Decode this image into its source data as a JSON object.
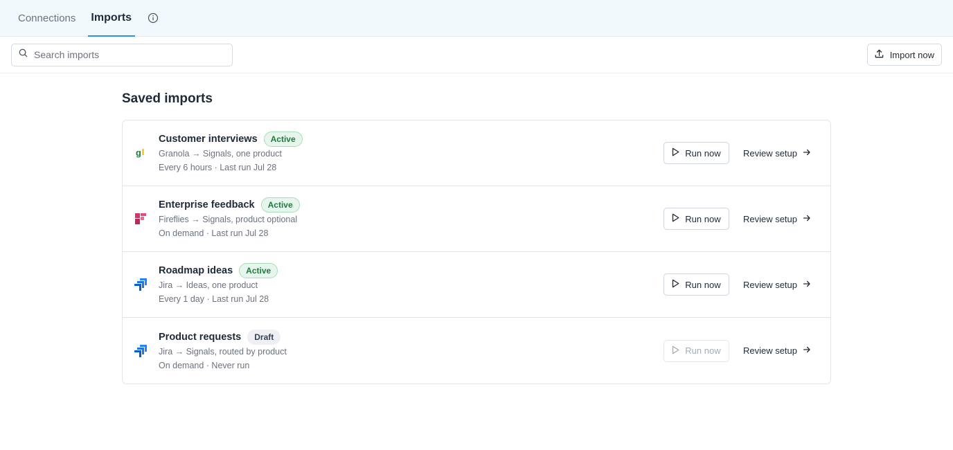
{
  "tabs": [
    {
      "label": "Connections",
      "active": false
    },
    {
      "label": "Imports",
      "active": true
    }
  ],
  "search": {
    "placeholder": "Search imports",
    "value": ""
  },
  "toolbar": {
    "import_label": "Import now"
  },
  "section": {
    "title": "Saved imports"
  },
  "imports": [
    {
      "title": "Customer interviews",
      "status": "Active",
      "source_line": "Granola → Signals, one product",
      "schedule_line": "Every 6 hours · Last run Jul 28",
      "icon": "granola-logo-icon",
      "run_label": "Run now",
      "run_enabled": true,
      "review_label": "Review setup"
    },
    {
      "title": "Enterprise feedback",
      "status": "Active",
      "source_line": "Fireflies → Signals, product optional",
      "schedule_line": "On demand · Last run Jul 28",
      "icon": "fireflies-logo-icon",
      "run_label": "Run now",
      "run_enabled": true,
      "review_label": "Review setup"
    },
    {
      "title": "Roadmap ideas",
      "status": "Active",
      "source_line": "Jira → Ideas, one product",
      "schedule_line": "Every 1 day · Last run Jul 28",
      "icon": "jira-logo-icon",
      "run_label": "Run now",
      "run_enabled": true,
      "review_label": "Review setup"
    },
    {
      "title": "Product requests",
      "status": "Draft",
      "source_line": "Jira → Signals, routed by product",
      "schedule_line": "On demand · Never run",
      "icon": "jira-logo-icon",
      "run_label": "Run now",
      "run_enabled": false,
      "review_label": "Review setup"
    }
  ],
  "colors": {
    "topbar_bg": "#f2f9fd",
    "active_tab_underline": "#2a93d5",
    "active_badge_bg": "#e7f6ec",
    "active_badge_text": "#1e7a3f",
    "draft_badge_bg": "#eef0f3",
    "granola_green": "#1e7a3f",
    "fireflies_pink": "#d6336c",
    "jira_blue": "#2684ff"
  }
}
